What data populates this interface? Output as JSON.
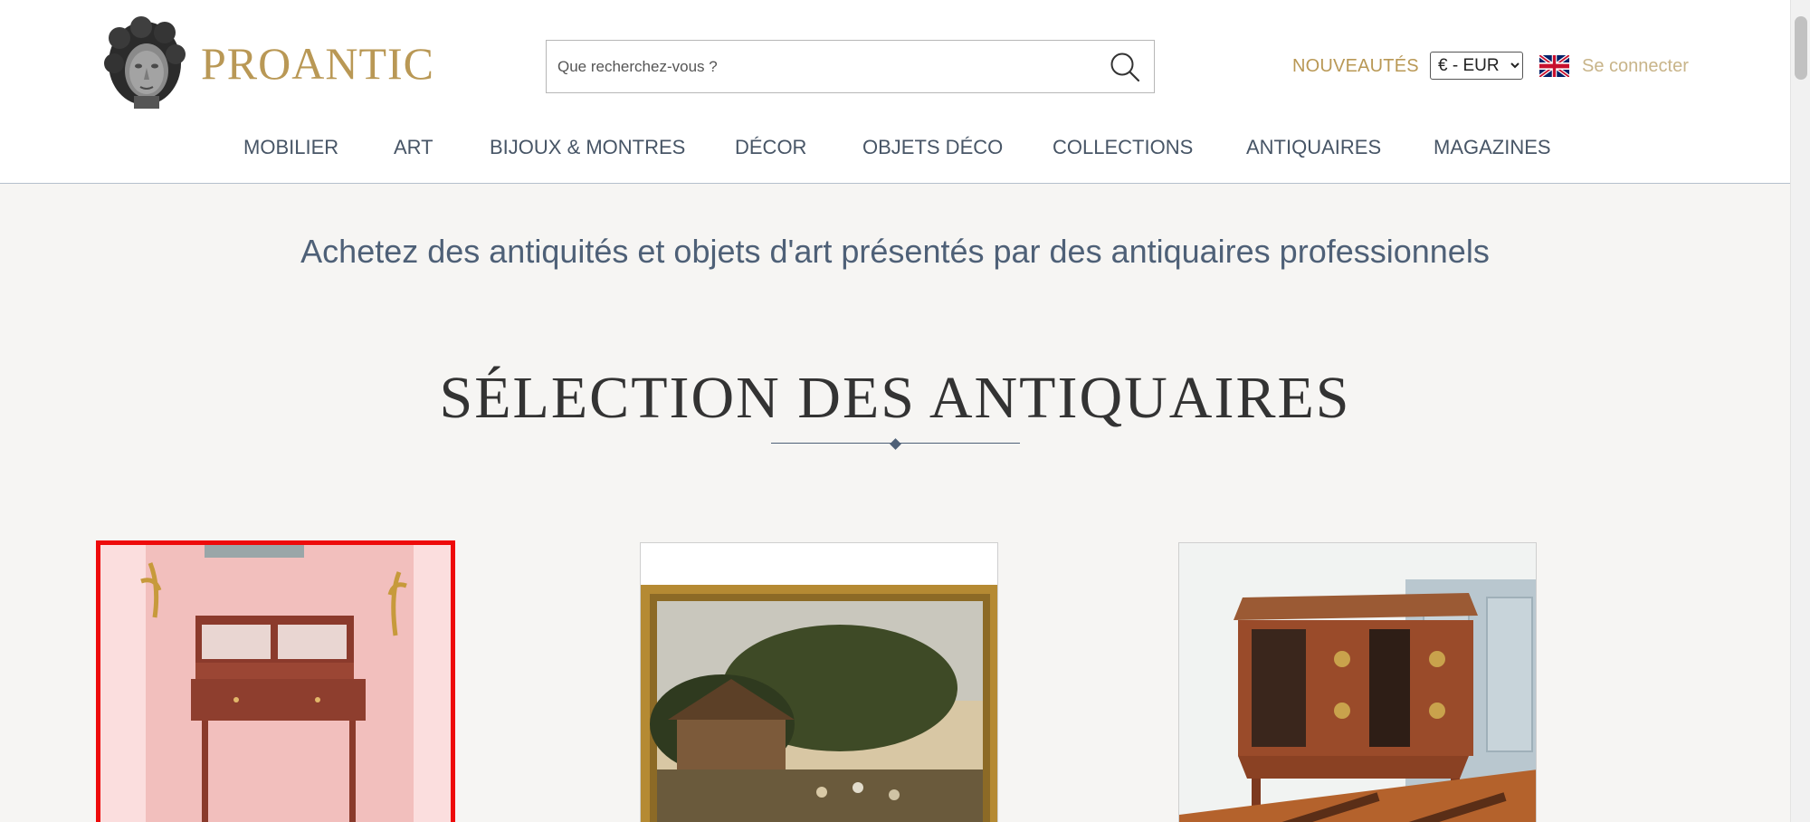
{
  "header": {
    "logo_text": "PROANTIC",
    "search_placeholder": "Que recherchez-vous ?",
    "nouveautes": "NOUVEAUTÉS",
    "currency_selected": "€ - EUR",
    "login": "Se connecter",
    "icons": {
      "logo": "statue-head-logo-icon",
      "search": "search-icon",
      "language": "uk-flag-icon"
    }
  },
  "nav": {
    "items": [
      "MOBILIER",
      "ART",
      "BIJOUX & MONTRES",
      "DÉCOR",
      "OBJETS DÉCO",
      "COLLECTIONS",
      "ANTIQUAIRES",
      "MAGAZINES"
    ]
  },
  "main": {
    "tagline": "Achetez des antiquités et objets d'art présentés par des antiquaires professionnels",
    "section_title": "SÉLECTION DES ANTIQUAIRES",
    "products": [
      {
        "image": "writing-desk-photo"
      },
      {
        "image": "framed-landscape-painting-photo"
      },
      {
        "image": "inlaid-commode-photo"
      }
    ]
  },
  "colors": {
    "brand_gold": "#b99855",
    "nav_text": "#475566",
    "tagline": "#4e6077",
    "highlight_border": "#ee0a0a",
    "background": "#f6f5f3"
  }
}
